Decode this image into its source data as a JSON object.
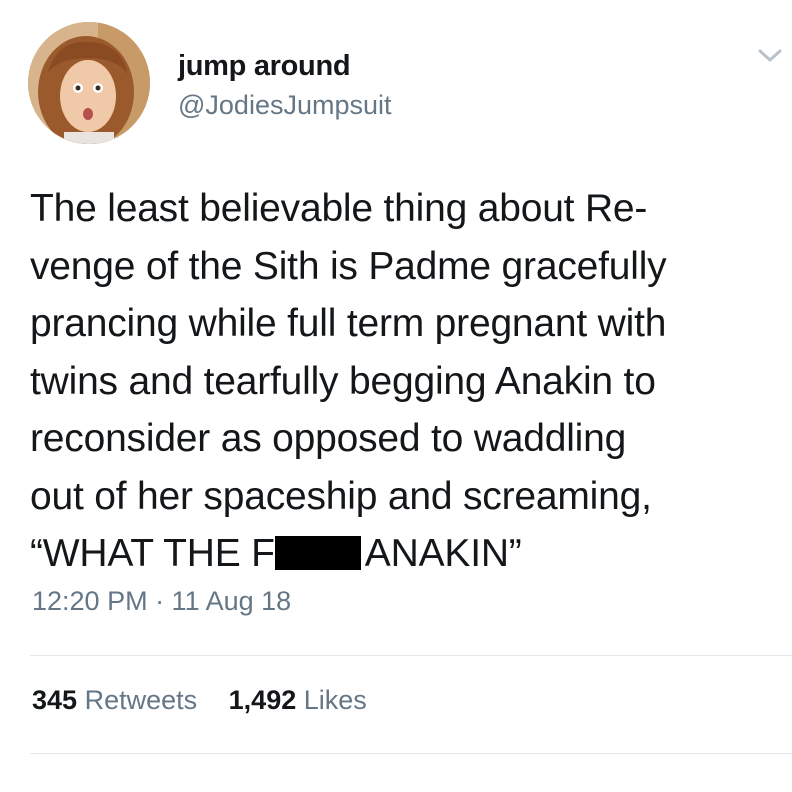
{
  "user": {
    "display_name": "jump around",
    "handle": "@JodiesJumpsuit",
    "avatar_icon": "profile-photo"
  },
  "tweet": {
    "lines": [
      "The least believable thing about Re-",
      "venge of the Sith is Padme gracefully",
      "prancing while full term pregnant with",
      "twins and tearfully begging Anakin to",
      "reconsider as opposed to waddling",
      "out of her spaceship and screaming,"
    ],
    "last_line_before_redaction": "“WHAT THE F",
    "last_line_after_redaction": "ANAKIN”",
    "timestamp": "12:20 PM · 11 Aug 18"
  },
  "stats": {
    "retweets_count": "345",
    "retweets_label": "Retweets",
    "likes_count": "1,492",
    "likes_label": "Likes"
  },
  "colors": {
    "text_primary": "#14171a",
    "text_secondary": "#657786",
    "divider": "#e1e8ed",
    "redaction": "#000000"
  },
  "icons": {
    "menu_caret": "chevron-down-icon"
  }
}
